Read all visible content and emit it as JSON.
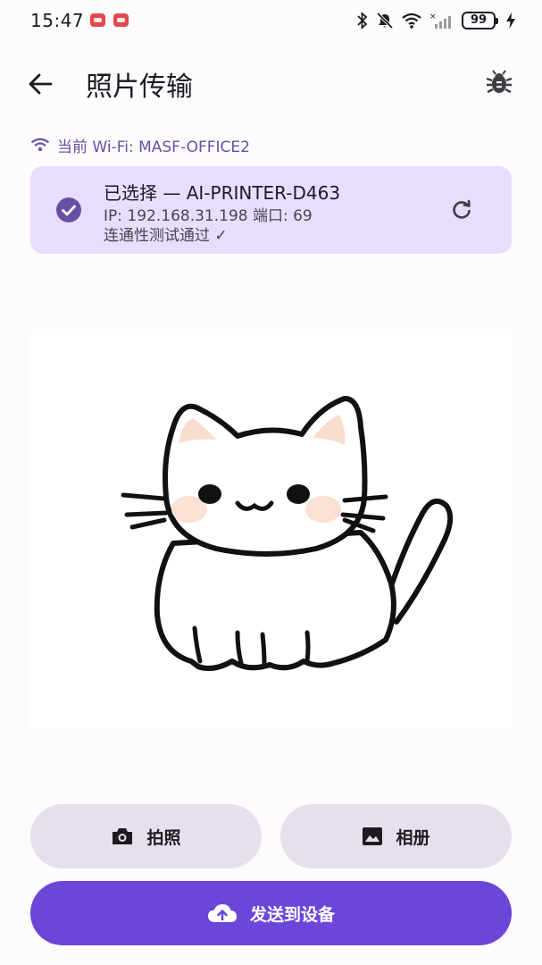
{
  "status_bar": {
    "time": "15:47",
    "battery": "99",
    "icons": [
      "bluetooth-icon",
      "bell-muted-icon",
      "wifi-icon",
      "signal-icon",
      "charging-icon"
    ]
  },
  "header": {
    "title": "照片传输",
    "back_icon": "arrow-left-icon",
    "debug_icon": "bug-icon"
  },
  "wifi": {
    "label": "当前 Wi-Fi: MASF-OFFICE2"
  },
  "device": {
    "name": "已选择 — AI-PRINTER-D463",
    "ip_line": "IP: 192.168.31.198  端口: 69",
    "status": "连通性测试通过 ✓"
  },
  "actions": {
    "camera_label": "拍照",
    "gallery_label": "相册",
    "send_label": "发送到设备"
  },
  "colors": {
    "accent": "#6750a4",
    "card_bg": "#e9ddff",
    "button_bg": "#e7e0ec",
    "send_bg": "#6c45d9"
  }
}
